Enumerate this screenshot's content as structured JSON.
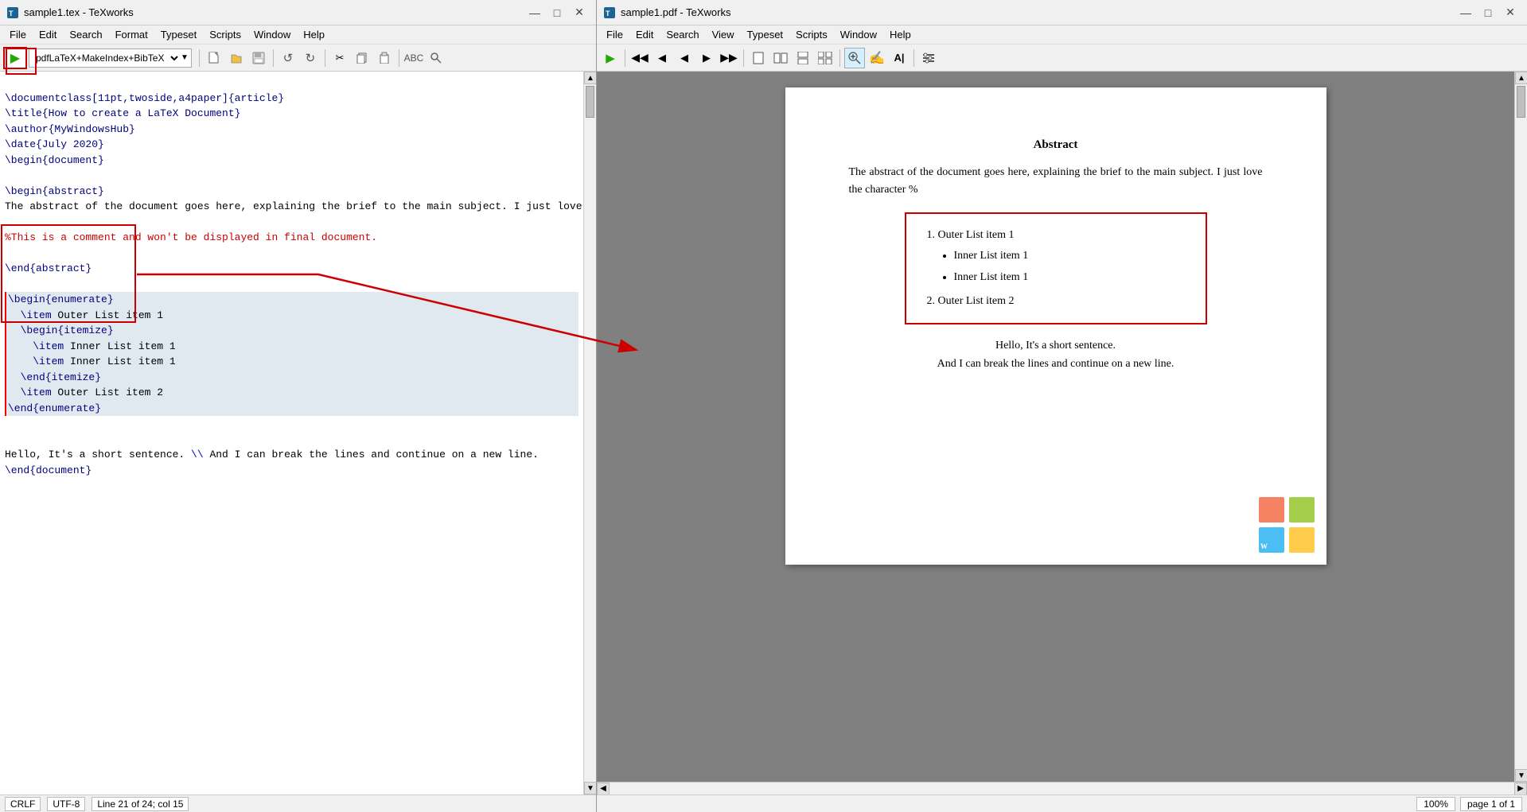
{
  "leftWindow": {
    "title": "sample1.tex - TeXworks",
    "menus": [
      "File",
      "Edit",
      "Search",
      "Format",
      "Typeset",
      "Scripts",
      "Window",
      "Help"
    ],
    "compiler": "pdfLaTeX+MakeIndex+BibTeX",
    "editorContent": {
      "lines": [
        {
          "type": "cmd",
          "text": "\\documentclass[11pt,twoside,a4paper]{article}"
        },
        {
          "type": "cmd",
          "text": "\\title{How to create a LaTeX Document}"
        },
        {
          "type": "cmd",
          "text": "\\author{MyWindowsHub}"
        },
        {
          "type": "cmd",
          "text": "\\date{July 2020}"
        },
        {
          "type": "cmd",
          "text": "\\begin{document}"
        },
        {
          "type": "blank",
          "text": ""
        },
        {
          "type": "cmd",
          "text": "\\begin{abstract}"
        },
        {
          "type": "mixed",
          "text": "The abstract of the document goes here, explaining the brief to the main subject. I just love the character ",
          "special": "\\%"
        },
        {
          "type": "blank",
          "text": ""
        },
        {
          "type": "comment",
          "text": "%This is a comment and won't be displayed in final document."
        },
        {
          "type": "blank",
          "text": ""
        },
        {
          "type": "cmd",
          "text": "\\end{abstract}"
        },
        {
          "type": "blank",
          "text": ""
        },
        {
          "type": "cmd-highlighted",
          "text": "\\begin{enumerate}"
        },
        {
          "type": "cmd-highlighted-indent1",
          "text": "  \\item Outer List item 1"
        },
        {
          "type": "cmd-highlighted-indent1",
          "text": "  \\begin{itemize}"
        },
        {
          "type": "cmd-highlighted-indent2",
          "text": "    \\item Inner List item 1"
        },
        {
          "type": "cmd-highlighted-indent2",
          "text": "    \\item Inner List item 1"
        },
        {
          "type": "cmd-highlighted-indent1",
          "text": "  \\end{itemize}"
        },
        {
          "type": "cmd-highlighted-indent1",
          "text": "  \\item Outer List item 2"
        },
        {
          "type": "cmd-highlighted",
          "text": "\\end{enumerate}"
        },
        {
          "type": "blank",
          "text": ""
        },
        {
          "type": "mixed-line",
          "text": "Hello, It's a short sentence. ",
          "special2": "\\\\ ",
          "text2": "And I can break the lines and continue on a new line."
        },
        {
          "type": "cmd",
          "text": "\\end{document}"
        }
      ]
    },
    "statusBar": {
      "lineEnding": "CRLF",
      "encoding": "UTF-8",
      "position": "Line 21 of 24; col 15"
    }
  },
  "rightWindow": {
    "title": "sample1.pdf - TeXworks",
    "menus": [
      "File",
      "Edit",
      "Search",
      "View",
      "Typeset",
      "Scripts",
      "Window",
      "Help"
    ],
    "pdfContent": {
      "abstractTitle": "Abstract",
      "abstractText": "The abstract of the document goes here, explaining the brief to the main subject. I just love the character %",
      "list": {
        "items": [
          {
            "type": "ordered",
            "text": "Outer List item 1"
          },
          {
            "type": "sub-bullet",
            "text": "Inner List item 1"
          },
          {
            "type": "sub-bullet",
            "text": "Inner List item 1"
          },
          {
            "type": "ordered",
            "text": "Outer List item 2"
          }
        ]
      },
      "closingText": [
        "Hello, It's a short sentence.",
        "And I can break the lines and continue on a new line."
      ]
    },
    "statusBar": {
      "zoom": "100%",
      "page": "page 1 of 1"
    }
  }
}
